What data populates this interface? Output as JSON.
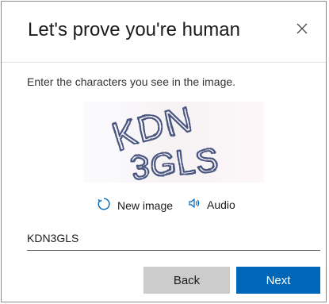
{
  "dialog": {
    "title": "Let's prove you're human",
    "instruction": "Enter the characters you see in the image.",
    "captcha": {
      "line1": "KDN",
      "line2": "3GLS"
    },
    "new_image_label": "New image",
    "audio_label": "Audio",
    "answer_value": "KDN3GLS",
    "back_label": "Back",
    "next_label": "Next",
    "accent_color": "#0067b8"
  },
  "icons": {
    "close": "close-icon",
    "refresh": "refresh-icon",
    "speaker": "speaker-icon"
  }
}
